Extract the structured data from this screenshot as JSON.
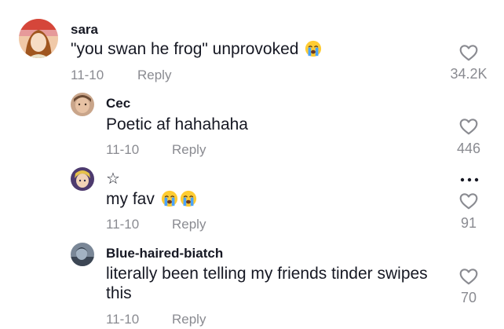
{
  "comments": [
    {
      "username": "sara",
      "text": "\"you swan he frog\" unprovoked",
      "date": "11-10",
      "reply_label": "Reply",
      "likes": "34.2K",
      "emoji": [
        "loudly-crying-face"
      ]
    },
    {
      "username": "Cec",
      "text": "Poetic af hahahaha",
      "date": "11-10",
      "reply_label": "Reply",
      "likes": "446"
    },
    {
      "username": "☆",
      "text": "my fav",
      "date": "11-10",
      "reply_label": "Reply",
      "likes": "91",
      "emoji": [
        "loudly-crying-face",
        "loudly-crying-face"
      ]
    },
    {
      "username": "Blue-haired-biatch",
      "text_line1": "literally been telling my friends tinder swipes",
      "text_line2": "this",
      "date": "11-10",
      "reply_label": "Reply",
      "likes": "70"
    }
  ],
  "icons": {
    "like": "heart-outline-icon",
    "more": "more-options-icon",
    "emoji": "loudly-crying-face"
  },
  "colors": {
    "text": "#161823",
    "muted": "#8a8b91"
  }
}
